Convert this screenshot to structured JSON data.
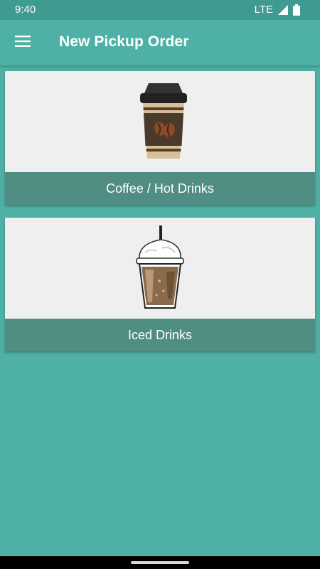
{
  "status_bar": {
    "time": "9:40",
    "network": "LTE",
    "signal_icon": "cell-signal-icon",
    "battery_icon": "battery-icon"
  },
  "app_bar": {
    "title": "New Pickup Order",
    "menu_icon": "menu-icon"
  },
  "categories": [
    {
      "label": "Coffee / Hot Drinks",
      "image": "hot-coffee-cup"
    },
    {
      "label": "Iced Drinks",
      "image": "iced-coffee-cup"
    }
  ],
  "colors": {
    "background": "#4fb0a5",
    "status_bar": "#3f9a90",
    "card_background": "#efefef",
    "card_label_bar": "#508d83"
  }
}
